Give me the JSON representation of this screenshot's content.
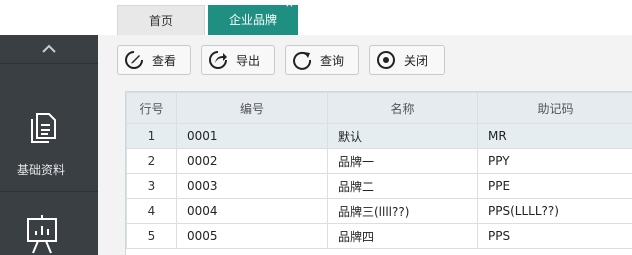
{
  "tabs": [
    {
      "label": "首页"
    },
    {
      "label": "企业品牌",
      "close": "×"
    }
  ],
  "sidebar": {
    "items": [
      {
        "label": "基础资料",
        "icon": "document-copy-icon"
      },
      {
        "label": "",
        "icon": "presentation-chart-icon"
      }
    ],
    "collapse_icon": "chevron-up-icon"
  },
  "toolbar": {
    "view": "查看",
    "export": "导出",
    "query": "查询",
    "close": "关闭"
  },
  "grid": {
    "headers": [
      "行号",
      "编号",
      "名称",
      "助记码"
    ],
    "rows": [
      [
        "1",
        "0001",
        "默认",
        "MR"
      ],
      [
        "2",
        "0002",
        "品牌一",
        "PPY"
      ],
      [
        "3",
        "0003",
        "品牌二",
        "PPE"
      ],
      [
        "4",
        "0004",
        "品牌三(llll??)",
        "PPS(LLLL??)"
      ],
      [
        "5",
        "0005",
        "品牌四",
        "PPS"
      ]
    ],
    "selected_row": 1
  },
  "colors": {
    "active_tab": "#1f8f82",
    "sidebar": "#3a3f44"
  }
}
